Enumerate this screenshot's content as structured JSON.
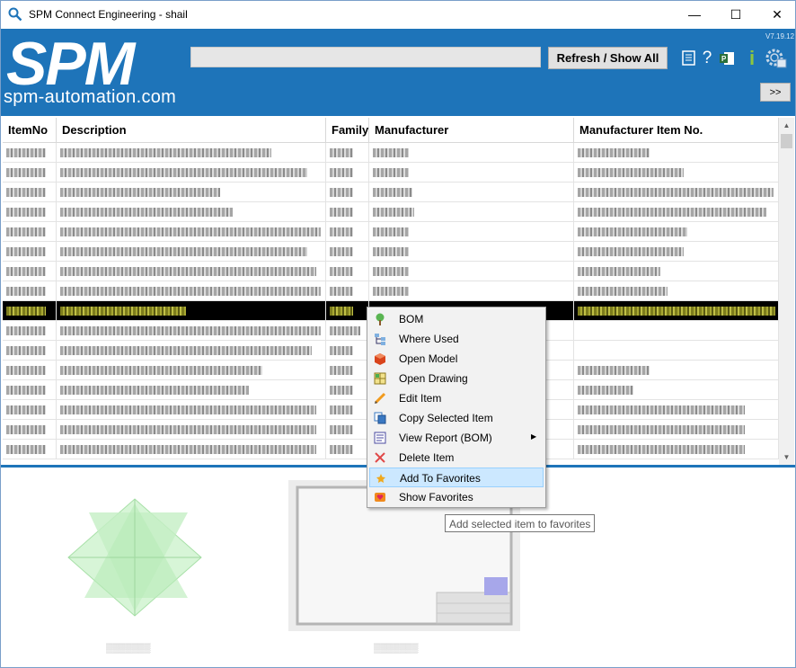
{
  "window": {
    "title": "SPM Connect Engineering - shail",
    "controls": {
      "minimize": "—",
      "maximize": "☐",
      "close": "✕"
    }
  },
  "header": {
    "logo_text": "SPM",
    "site_url": "spm-automation.com",
    "search_value": "",
    "refresh_label": "Refresh / Show All",
    "version": "V7.19.12",
    "expand_label": ">>",
    "icons": [
      "report-icon",
      "help-icon",
      "project-icon",
      "info-icon",
      "settings-user-icon"
    ],
    "accent_color": "#1e74b9"
  },
  "grid": {
    "columns": [
      "ItemNo",
      "Description",
      "Family",
      "Manufacturer",
      "Manufacturer Item No."
    ],
    "selected_row_index": 8,
    "row_count": 16
  },
  "context_menu": {
    "items": [
      {
        "label": "BOM",
        "icon": "bom-tree-icon"
      },
      {
        "label": "Where Used",
        "icon": "where-used-icon"
      },
      {
        "label": "Open Model",
        "icon": "open-model-icon"
      },
      {
        "label": "Open Drawing",
        "icon": "open-drawing-icon"
      },
      {
        "label": "Edit Item",
        "icon": "edit-pencil-icon"
      },
      {
        "label": "Copy Selected Item",
        "icon": "copy-icon"
      },
      {
        "label": "View Report (BOM)",
        "icon": "view-report-icon",
        "submenu": true
      },
      {
        "label": "Delete Item",
        "icon": "delete-x-icon"
      },
      {
        "label": "Add To Favorites",
        "icon": "add-favorite-icon",
        "highlighted": true
      },
      {
        "label": "Show Favorites",
        "icon": "show-favorites-icon"
      }
    ]
  },
  "tooltip": {
    "text": "Add selected item to favorites"
  }
}
